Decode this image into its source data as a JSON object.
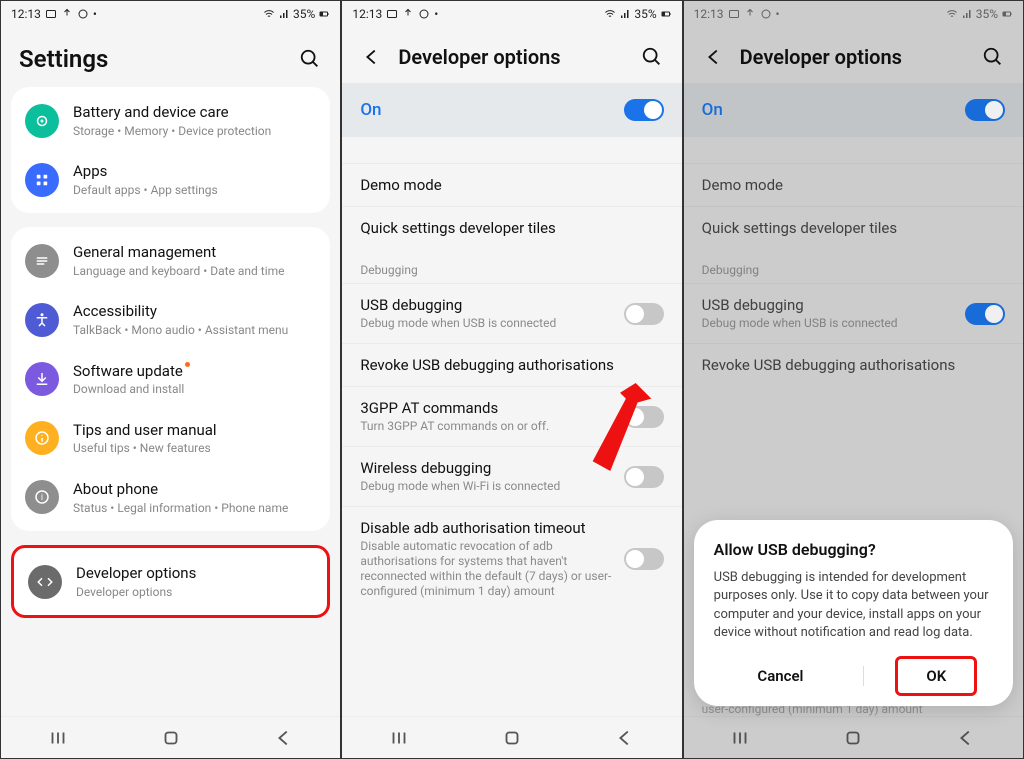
{
  "status": {
    "time": "12:13",
    "icons_left": [
      "gallery-icon",
      "upload-icon",
      "clock-icon",
      "dot-icon"
    ],
    "icons_right": [
      "wifi-icon",
      "signal-icon"
    ],
    "battery_text": "35%"
  },
  "screen1": {
    "title": "Settings",
    "groups": [
      {
        "items": [
          {
            "key": "battery",
            "title": "Battery and device care",
            "sub": "Storage  •  Memory  •  Device protection",
            "icon_color": "#0bbf9c"
          },
          {
            "key": "apps",
            "title": "Apps",
            "sub": "Default apps  •  App settings",
            "icon_color": "#3a6bff"
          }
        ]
      },
      {
        "items": [
          {
            "key": "general",
            "title": "General management",
            "sub": "Language and keyboard  •  Date and time",
            "icon_color": "#8e8e8e"
          },
          {
            "key": "accessibility",
            "title": "Accessibility",
            "sub": "TalkBack  •  Mono audio  •  Assistant menu",
            "icon_color": "#4f5bd5"
          },
          {
            "key": "software",
            "title": "Software update",
            "sub": "Download and install",
            "icon_color": "#7c5ae0",
            "badge": true
          },
          {
            "key": "tips",
            "title": "Tips and user manual",
            "sub": "Useful tips  •  New features",
            "icon_color": "#ffb020"
          },
          {
            "key": "about",
            "title": "About phone",
            "sub": "Status  •  Legal information  •  Phone name",
            "icon_color": "#8e8e8e"
          }
        ]
      },
      {
        "items": [
          {
            "key": "developer",
            "title": "Developer options",
            "sub": "Developer options",
            "icon_color": "#6b6b6b",
            "highlight": true
          }
        ]
      }
    ]
  },
  "screen2": {
    "title": "Developer options",
    "on_label": "On",
    "section_debugging": "Debugging",
    "items_top": [
      {
        "key": "demo",
        "title": "Demo mode"
      },
      {
        "key": "quicktiles",
        "title": "Quick settings developer tiles"
      }
    ],
    "items_debug": [
      {
        "key": "usb",
        "title": "USB debugging",
        "sub": "Debug mode when USB is connected",
        "toggle": "off"
      },
      {
        "key": "revoke",
        "title": "Revoke USB debugging authorisations"
      },
      {
        "key": "3gpp",
        "title": "3GPP AT commands",
        "sub": "Turn 3GPP AT commands on or off.",
        "toggle": "off"
      },
      {
        "key": "wireless",
        "title": "Wireless debugging",
        "sub": "Debug mode when Wi-Fi is connected",
        "toggle": "off"
      },
      {
        "key": "disableadb",
        "title": "Disable adb authorisation timeout",
        "sub": "Disable automatic revocation of adb authorisations for systems that haven't reconnected within the default (7 days) or user-configured (minimum 1 day) amount",
        "toggle": "off"
      }
    ]
  },
  "screen3": {
    "title": "Developer options",
    "on_label": "On",
    "section_debugging": "Debugging",
    "items_top": [
      {
        "key": "demo",
        "title": "Demo mode"
      },
      {
        "key": "quicktiles",
        "title": "Quick settings developer tiles"
      }
    ],
    "items_debug": [
      {
        "key": "usb",
        "title": "USB debugging",
        "sub": "Debug mode when USB is connected",
        "toggle": "on"
      },
      {
        "key": "revoke",
        "title": "Revoke USB debugging authorisations"
      }
    ],
    "bg_hint": "user-configured (minimum 1 day) amount",
    "dialog": {
      "title": "Allow USB debugging?",
      "body": "USB debugging is intended for development purposes only. Use it to copy data between your computer and your device, install apps on your device without notification and read log data.",
      "cancel": "Cancel",
      "ok": "OK"
    }
  }
}
